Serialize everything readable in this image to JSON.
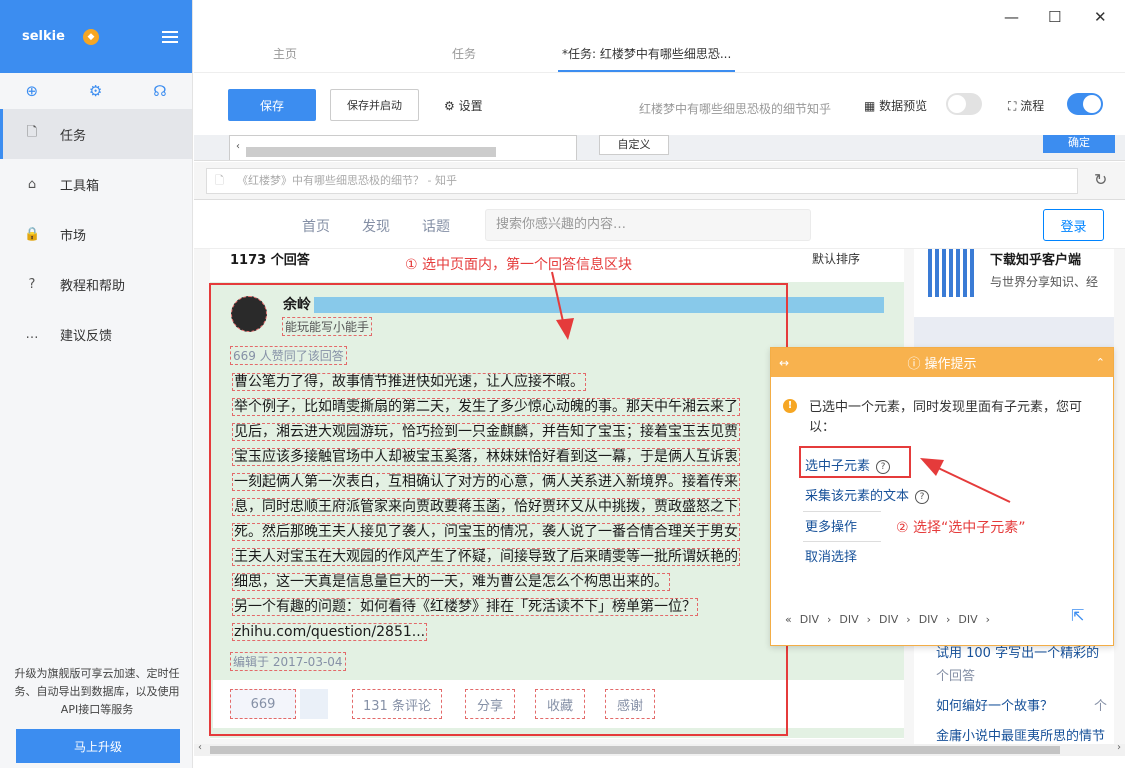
{
  "app": {
    "brand": "selkie",
    "badge": "◆",
    "window_controls": [
      "—",
      "☐",
      "✕"
    ]
  },
  "sidebar": {
    "tools": [
      "⊕",
      "⚙",
      "☊"
    ],
    "items": [
      {
        "label": "任务",
        "icon": "🗋",
        "active": true
      },
      {
        "label": "工具箱",
        "icon": "⌂"
      },
      {
        "label": "市场",
        "icon": "🔒"
      },
      {
        "label": "教程和帮助",
        "icon": "?"
      },
      {
        "label": "建议反馈",
        "icon": "…"
      }
    ],
    "promo": "升级为旗舰版可享云加速、定时任务、自动导出到数据库，以及使用API接口等服务",
    "upgrade_button": "马上升级"
  },
  "tabs": [
    {
      "label": "主页"
    },
    {
      "label": "任务"
    },
    {
      "label": "*任务: 红楼梦中有哪些细思恐...",
      "active": true
    }
  ],
  "toolbar": {
    "save": "保存",
    "save_start": "保存并启动",
    "settings": "设置",
    "task_title": "红楼梦中有哪些细思恐极的细节知乎",
    "data_preview": "数据预览",
    "data_preview_on": false,
    "flow": "流程",
    "flow_on": true
  },
  "strip": {
    "custom": "自定义",
    "confirm": "确定"
  },
  "browser": {
    "url": "《红楼梦》中有哪些细思恐极的细节？ - 知乎",
    "refresh": "↻"
  },
  "zhihu": {
    "nav": [
      "首页",
      "发现",
      "话题"
    ],
    "search_placeholder": "搜索你感兴趣的内容…",
    "login": "登录",
    "answer_count": "1173 个回答",
    "sort": "默认排序",
    "author": "余岭",
    "bio": "能玩能写小能手",
    "votes": "669 人赞同了该回答",
    "body": [
      "曹公笔力了得，故事情节推进快如光速，让人应接不暇。",
      "举个例子，比如晴雯撕扇的第二天，发生了多少惊心动魄的事。那天中午湘云来了",
      "见后，湘云进大观园游玩，恰巧捡到一只金麒麟，并告知了宝玉；接着宝玉去见贾",
      "宝玉应该多接触官场中人却被宝玉奚落，林妹妹恰好看到这一幕，于是俩人互诉衷",
      "一刻起俩人第一次表白，互相确认了对方的心意，俩人关系进入新境界。接着传来",
      "息，同时忠顺王府派管家来向贾政要蒋玉菡，恰好贾环又从中挑拨，贾政盛怒之下",
      "死。然后那晚王夫人接见了袭人，问宝玉的情况，袭人说了一番合情合理关于男女",
      "王夫人对宝玉在大观园的作风产生了怀疑，间接导致了后来晴雯等一批所谓妖艳的",
      "细思，这一天真是信息量巨大的一天，难为曹公是怎么个构思出来的。",
      "另一个有趣的问题：如何看待《红楼梦》排在「死活读不下」榜单第一位？",
      "zhihu.com/question/2851..."
    ],
    "edited": "编辑于 2017-03-04",
    "actions": [
      "669",
      "131 条评论",
      "分享",
      "收藏",
      "感谢"
    ],
    "side_download_title": "下载知乎客户端",
    "side_download_sub": "与世界分享知识、经",
    "side_links": [
      "试用 100 字写出一个精彩的",
      "个回答",
      "如何编好一个故事？",
      "个",
      "金庸小说中最匪夷所思的情节"
    ]
  },
  "annotations": {
    "step1": "① 选中页面内，第一个回答信息区块",
    "step2": "② 选择“选中子元素”"
  },
  "hint": {
    "title": "操作提示",
    "message": "已选中一个元素，同时发现里面有子元素，您可以：",
    "options": [
      "选中子元素",
      "采集该元素的文本",
      "更多操作",
      "取消选择"
    ],
    "crumbs": [
      "DIV",
      "DIV",
      "DIV",
      "DIV",
      "DIV"
    ],
    "crumb_prev": "«",
    "crumb_sep": "›",
    "expand": "⇱"
  },
  "colors": {
    "accent": "#3c8df0",
    "hint_orange": "#f8b24e",
    "annotation_red": "#e53b3b",
    "selection_green": "#e3f1e3",
    "zhihu_blue": "#0084ff"
  }
}
